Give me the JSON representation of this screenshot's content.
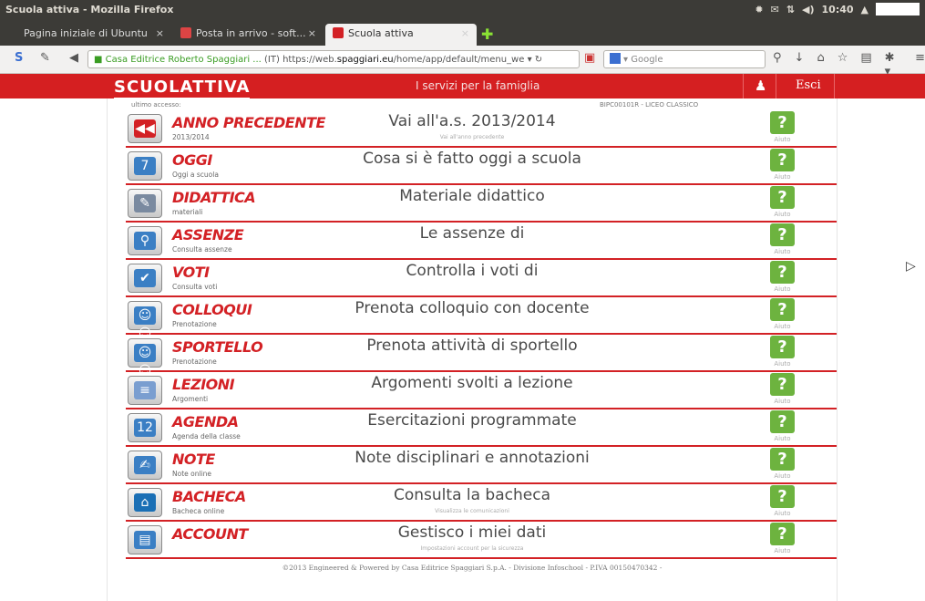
{
  "window": {
    "title": "Scuola attiva - Mozilla Firefox",
    "clock": "10:40"
  },
  "tabs": [
    {
      "label": "Pagina iniziale di Ubuntu",
      "close": "×"
    },
    {
      "label": "Posta in arrivo - soft...",
      "close": "×"
    },
    {
      "label": "Scuola attiva",
      "close": "×"
    }
  ],
  "newtab": "✚",
  "nav": {
    "site_identity": "Casa Editrice Roberto Spaggiari ...",
    "country": "(IT)",
    "url_prefix": "https://web.",
    "url_host": "spaggiari.eu",
    "url_path": "/home/app/default/menu_we",
    "search_placeholder": "Google"
  },
  "header": {
    "logo": "SCUOLATTIVA",
    "tagline": "I servizi per la famiglia",
    "logout": "Esci"
  },
  "info": {
    "left": "ultimo accesso:",
    "right": "BIPC00101R - LICEO CLASSICO"
  },
  "help_label": "Aiuto",
  "help_glyph": "?",
  "rows": [
    {
      "label": "ANNO PRECEDENTE",
      "sub": "2013/2014",
      "desc": "Vai all'a.s. 2013/2014",
      "desc_sub": "Vai all'anno precedente",
      "icon": "calendar-back-icon",
      "glyph": "◀◀",
      "color": "#d32125"
    },
    {
      "label": "OGGI",
      "sub": "Oggi a scuola",
      "desc": "Cosa si è fatto oggi a scuola",
      "desc_sub": "",
      "icon": "calendar-day-icon",
      "glyph": "7",
      "color": "#3b7fc4"
    },
    {
      "label": "DIDATTICA",
      "sub": "materiali",
      "desc": "Materiale didattico",
      "desc_sub": "",
      "icon": "didactic-material-icon",
      "glyph": "✎",
      "color": "#7a8aa0"
    },
    {
      "label": "ASSENZE",
      "sub": "Consulta assenze",
      "desc": "Le assenze di",
      "desc_sub": "",
      "icon": "magnifier-icon",
      "glyph": "⚲",
      "color": "#3b7fc4"
    },
    {
      "label": "VOTI",
      "sub": "Consulta voti",
      "desc": "Controlla i voti di",
      "desc_sub": "",
      "icon": "grades-icon",
      "glyph": "✔",
      "color": "#3b7fc4"
    },
    {
      "label": "COLLOQUI",
      "sub": "Prenotazione",
      "desc": "Prenota colloquio con docente",
      "desc_sub": "",
      "icon": "people-icon",
      "glyph": "☺☺",
      "color": "#3b7fc4"
    },
    {
      "label": "SPORTELLO",
      "sub": "Prenotazione",
      "desc": "Prenota attività di sportello",
      "desc_sub": "",
      "icon": "people-icon",
      "glyph": "☺☺",
      "color": "#3b7fc4"
    },
    {
      "label": "LEZIONI",
      "sub": "Argomenti",
      "desc": "Argomenti svolti a lezione",
      "desc_sub": "",
      "icon": "notebook-icon",
      "glyph": "≡",
      "color": "#7a9ed0"
    },
    {
      "label": "AGENDA",
      "sub": "Agenda della classe",
      "desc": "Esercitazioni programmate",
      "desc_sub": "",
      "icon": "agenda-icon",
      "glyph": "12",
      "color": "#3b7fc4"
    },
    {
      "label": "NOTE",
      "sub": "Note online",
      "desc": "Note disciplinari e annotazioni",
      "desc_sub": "",
      "icon": "notes-icon",
      "glyph": "✍",
      "color": "#3b7fc4"
    },
    {
      "label": "BACHECA",
      "sub": "Bacheca online",
      "desc": "Consulta la bacheca",
      "desc_sub": "Visualizza le comunicazioni",
      "icon": "home-icon",
      "glyph": "⌂",
      "color": "#1a6fb5"
    },
    {
      "label": "ACCOUNT",
      "sub": "",
      "desc": "Gestisco i miei dati",
      "desc_sub": "Impostazioni account per la sicurezza",
      "icon": "id-card-icon",
      "glyph": "▤",
      "color": "#3b7fc4"
    }
  ],
  "footer": "©2013 Engineered & Powered by Casa Editrice Spaggiari S.p.A. - Divisione Infoschool - P.IVA 00150470342 -"
}
